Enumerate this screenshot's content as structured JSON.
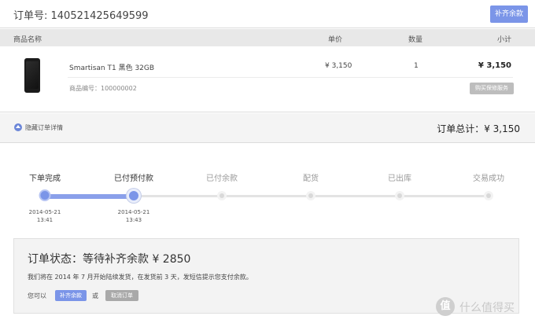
{
  "header": {
    "order_no": "订单号: 140521425649599",
    "pay_balance_label": "补齐余款"
  },
  "columns": {
    "name": "商品名称",
    "price": "单价",
    "qty": "数量",
    "subtotal": "小计"
  },
  "product": {
    "name": "Smartisan T1 黑色 32GB",
    "price": "¥ 3,150",
    "qty": "1",
    "subtotal": "¥ 3,150",
    "code": "商品编号：100000002",
    "warranty_label": "购买保修服务"
  },
  "summary": {
    "toggle_label": "隐藏订单详情",
    "total": "订单总计：¥ 3,150"
  },
  "steps": [
    {
      "label": "下单完成",
      "state": "done",
      "date": "2014-05-21",
      "time": "13:41"
    },
    {
      "label": "已付预付款",
      "state": "current",
      "date": "2014-05-21",
      "time": "13:43"
    },
    {
      "label": "已付余款",
      "state": "todo"
    },
    {
      "label": "配货",
      "state": "todo"
    },
    {
      "label": "已出库",
      "state": "todo"
    },
    {
      "label": "交易成功",
      "state": "todo"
    }
  ],
  "status": {
    "title": "订单状态：等待补齐余款 ¥ 2850",
    "desc": "我们将在 2014 年 7 月开始陆续发货，在发货前 3 天，发短信提示您支付余款。",
    "can_label": "您可以",
    "pay_label": "补齐余款",
    "or_label": "或",
    "cancel_label": "取消订单"
  },
  "watermark": {
    "logo": "值",
    "text": "什么值得买"
  },
  "colors": {
    "accent": "#7b95e8",
    "progress": "#8aa0ea",
    "muted_button": "#a9a9a9"
  }
}
